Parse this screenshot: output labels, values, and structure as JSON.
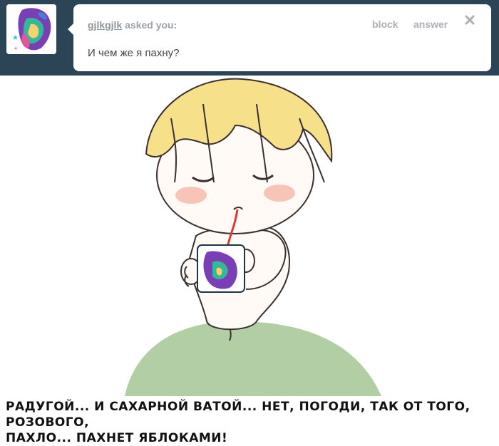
{
  "ask": {
    "asker_name": "gjlkgjlk",
    "asked_suffix": "asked you:",
    "question": "И чем же я пахну?",
    "block_label": "block",
    "answer_label": "answer"
  },
  "caption": "РАДУГОЙ... И САХАРНОЙ ВАТОЙ... НЕТ, ПОГОДИ, ТАК ОТ ТОГО, РОЗОВОГО,\nПАХЛО... ПАХНЕТ ЯБЛОКАМИ!",
  "colors": {
    "header_bg": "#2b4556",
    "hair": "#f7e08a",
    "blush": "#f6b6a8",
    "skirt": "#a9c99a",
    "straw": "#d93a3a"
  },
  "icons": {
    "close": "close-icon",
    "avatar": "avatar"
  }
}
